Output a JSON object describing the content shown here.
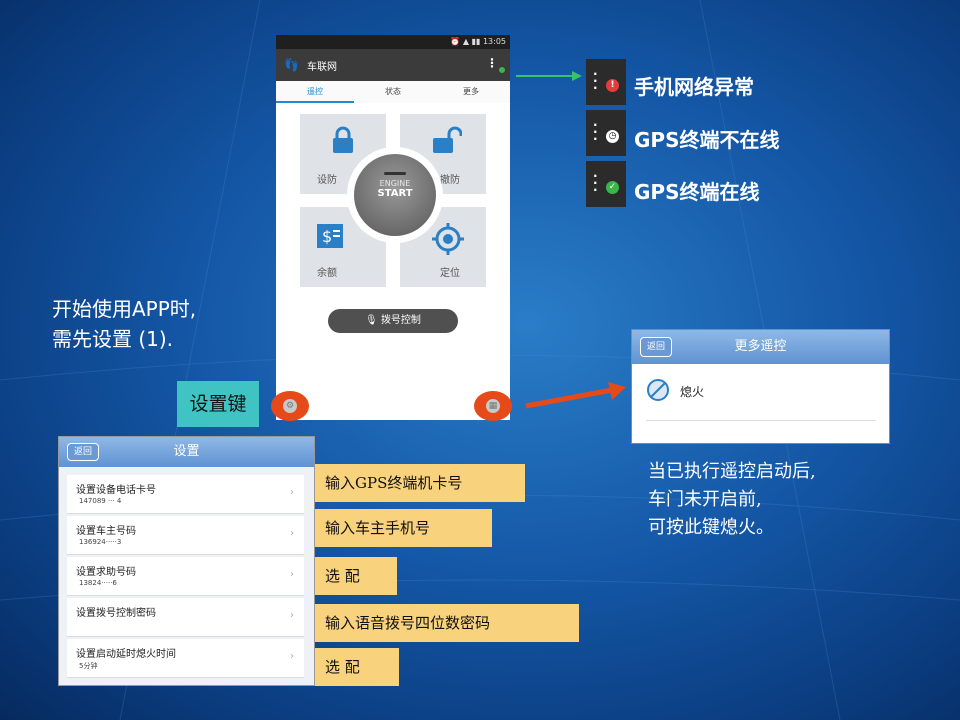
{
  "colors": {
    "accent": "#1a8ccf",
    "alert_red": "#e64a19",
    "online_green": "#3ab54a",
    "error_red": "#e23c3c",
    "note_yellow": "#f8d27d",
    "setkey_cyan": "#3fc3c3"
  },
  "phone": {
    "status_time": "13:05",
    "app_title": "车联网",
    "tabs": [
      "遥控",
      "状态",
      "更多"
    ],
    "tiles": {
      "arm": "设防",
      "disarm": "撤防",
      "balance": "余额",
      "locate": "定位"
    },
    "engine": {
      "line1": "ENGINE",
      "line2": "START"
    },
    "dial_button": "拨号控制"
  },
  "legend": [
    {
      "label": "手机网络异常",
      "icon": "error-badge-icon"
    },
    {
      "label": "GPS终端不在线",
      "icon": "clock-badge-icon"
    },
    {
      "label": "GPS终端在线",
      "icon": "check-badge-icon"
    }
  ],
  "intro_note": {
    "line1": "开始使用APP时,",
    "line2": "需先设置 (1)."
  },
  "setkey_label": "设置键",
  "more_panel": {
    "back": "返回",
    "title": "更多遥控",
    "item": "熄火"
  },
  "more_note": {
    "line1": "当已执行遥控启动后,",
    "line2": "车门未开启前,",
    "line3": "可按此键熄火。"
  },
  "settings_panel": {
    "back": "返回",
    "title": "设置",
    "rows": [
      {
        "title": "设置设备电话卡号",
        "sub": "147089  ···  4"
      },
      {
        "title": "设置车主号码",
        "sub": "136924·····3"
      },
      {
        "title": "设置求助号码",
        "sub": "13824·····6"
      },
      {
        "title": "设置拨号控制密码",
        "sub": ""
      },
      {
        "title": "设置启动延时熄火时间",
        "sub": "5分钟"
      }
    ]
  },
  "setting_notes": [
    "输入GPS终端机卡号",
    "输入车主手机号",
    "选  配",
    "输入语音拨号四位数密码",
    "选  配"
  ]
}
